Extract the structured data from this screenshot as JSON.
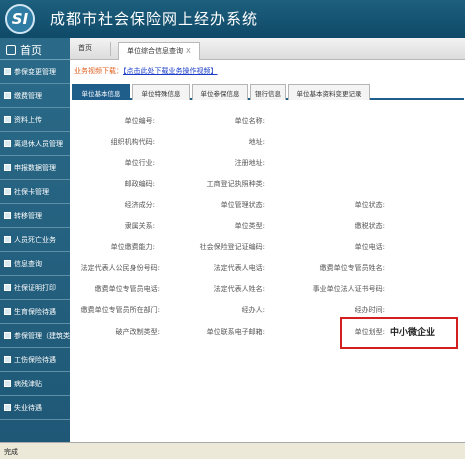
{
  "app": {
    "title": "成都市社会保险网上经办系统",
    "logo_text": "SI"
  },
  "sidebar": {
    "home_label": "首页",
    "items": [
      {
        "label": "参保变更管理"
      },
      {
        "label": "缴费管理"
      },
      {
        "label": "资料上传"
      },
      {
        "label": "离退休人员管理"
      },
      {
        "label": "申报数据管理"
      },
      {
        "label": "社保卡管理"
      },
      {
        "label": "转移管理"
      },
      {
        "label": "人员死亡业务"
      },
      {
        "label": "信息查询"
      },
      {
        "label": "社保证明打印"
      },
      {
        "label": "生育保险待遇"
      },
      {
        "label": "参保管理（建筑类）"
      },
      {
        "label": "工伤保险待遇"
      },
      {
        "label": "病残津贴"
      },
      {
        "label": "失业待遇"
      }
    ]
  },
  "tabs": {
    "home": "首页",
    "active": "单位综合信息查询",
    "close": "X"
  },
  "notice": {
    "prefix": "业务视频下载：",
    "link": "【点击此处下载业务操作视频】"
  },
  "subtabs": [
    "单位基本信息",
    "单位特殊信息",
    "单位参保信息",
    "银行信息",
    "单位基本资料变更记录"
  ],
  "form": {
    "fields": [
      "单位编号:",
      "单位名称:",
      "组织机构代码:",
      "地址:",
      "单位行业:",
      "注册地址:",
      "邮政编码:",
      "工商登记执照种类:",
      "经济成分:",
      "单位管理状态:",
      "单位状态:",
      "隶属关系:",
      "单位类型:",
      "缴税状态:",
      "单位缴费能力:",
      "社会保险登记证编码:",
      "单位电话:",
      "法定代表人公民身份号码:",
      "法定代表人电话:",
      "缴费单位专管员姓名:",
      "缴费单位专管员电话:",
      "法定代表人姓名:",
      "事业单位法人证书号码:",
      "缴费单位专管员所在部门:",
      "经办人:",
      "经办时间:",
      "破产改制类型:",
      "单位联系电子邮箱:",
      "单位划型:"
    ],
    "enterprise_type_value": "中小微企业"
  },
  "status_bar": "完成",
  "colors": {
    "accent": "#1f5d8a",
    "highlight_box": "#d21f1f",
    "notice": "#e06020"
  }
}
